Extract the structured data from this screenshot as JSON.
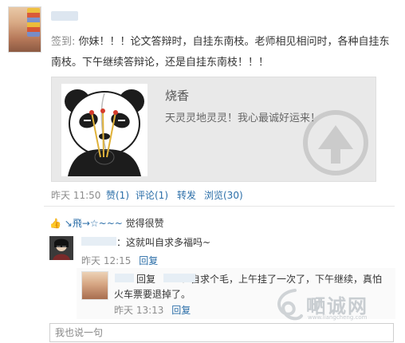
{
  "post": {
    "signin_prefix": "签到:",
    "body": "你妹！！！论文答辩时，自挂东南枝。老师相见相问时，各种自挂东南枝。下午继续答辩论，还是自挂东南枝！！！"
  },
  "card": {
    "title": "烧香",
    "description": "天灵灵地灵灵！我心最诚好运来！"
  },
  "meta": {
    "time": "昨天 11:50",
    "like": "赞(1)",
    "comment": "评论(1)",
    "repost": "转发",
    "views": "浏览(30)"
  },
  "likes": {
    "user": "↘飛→☆~~~",
    "suffix": "觉得很赞"
  },
  "comments": [
    {
      "text": "：这就叫自求多福吗~",
      "time": "昨天 12:15",
      "reply_label": "回复"
    },
    {
      "reply_prefix": "回复",
      "text": "：自求个毛，上午挂了一次了，下午继续，真怕火车票要退掉了。",
      "time": "昨天 13:13",
      "reply_label": "回复"
    }
  ],
  "watermark": {
    "brand": "嗮诚网",
    "url": "www.liangcheng.com"
  },
  "comment_input": {
    "placeholder": "我也说一句"
  }
}
